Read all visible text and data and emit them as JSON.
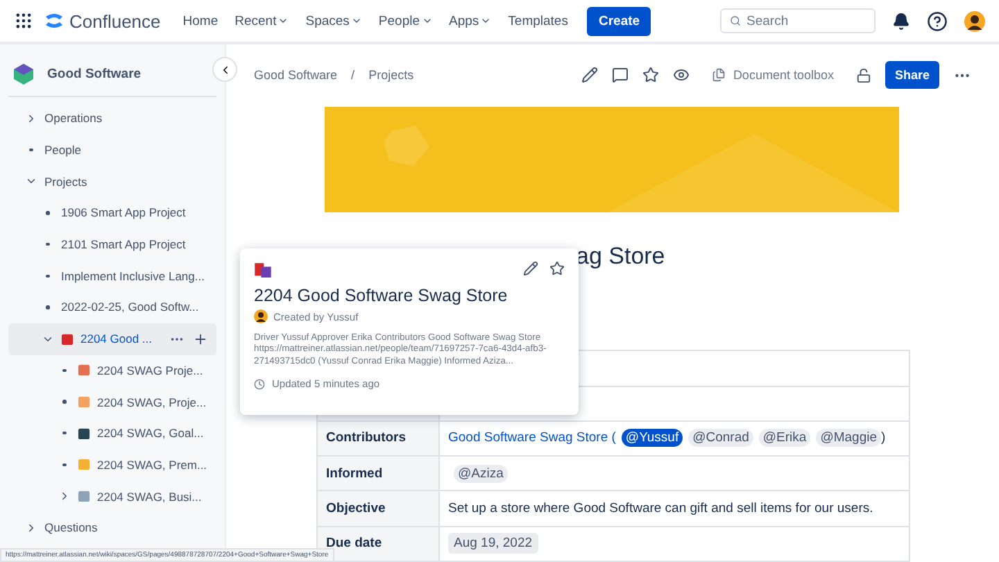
{
  "topnav": {
    "product": "Confluence",
    "links": [
      {
        "label": "Home",
        "dropdown": false
      },
      {
        "label": "Recent",
        "dropdown": true
      },
      {
        "label": "Spaces",
        "dropdown": true
      },
      {
        "label": "People",
        "dropdown": true
      },
      {
        "label": "Apps",
        "dropdown": true
      },
      {
        "label": "Templates",
        "dropdown": false
      }
    ],
    "create": "Create",
    "search": {
      "placeholder": "Search"
    }
  },
  "sidebar": {
    "space": "Good Software",
    "tree": [
      {
        "label": "Operations",
        "kind": "branch",
        "expanded": false,
        "selected": false
      },
      {
        "label": "People",
        "kind": "leaf",
        "selected": false
      },
      {
        "label": "Projects",
        "kind": "branch",
        "expanded": true,
        "selected": false,
        "children": [
          {
            "label": "1906 Smart App Project",
            "kind": "leaf",
            "selected": false
          },
          {
            "label": "2101 Smart App Project",
            "kind": "leaf",
            "selected": false
          },
          {
            "label": "Implement Inclusive Lang...",
            "kind": "leaf",
            "selected": false
          },
          {
            "label": "2022-02-25, Good Softw...",
            "kind": "leaf",
            "selected": false
          },
          {
            "label": "2204 Good ...",
            "kind": "branch",
            "expanded": true,
            "selected": true,
            "color": "#d62828",
            "children": [
              {
                "label": "2204 SWAG Proje...",
                "kind": "leaf",
                "selected": false,
                "color": "#e76f51"
              },
              {
                "label": "2204 SWAG, Proje...",
                "kind": "leaf",
                "selected": false,
                "color": "#f4a261"
              },
              {
                "label": "2204 SWAG, Goal...",
                "kind": "leaf",
                "selected": false,
                "color": "#264653"
              },
              {
                "label": "2204 SWAG, Prem...",
                "kind": "leaf",
                "selected": false,
                "color": "#f2b134"
              },
              {
                "label": "2204 SWAG, Busi...",
                "kind": "branch",
                "expanded": false,
                "selected": false,
                "color": "#8fa3b8"
              }
            ]
          }
        ]
      },
      {
        "label": "Questions",
        "kind": "branch",
        "expanded": false,
        "selected": false
      }
    ]
  },
  "page": {
    "breadcrumbs": [
      "Good Software",
      "Projects"
    ],
    "breadcrumb_separator": "/",
    "toolbox": "Document toolbox",
    "share": "Share",
    "title_visible": "ag Store",
    "table": [
      {
        "label": "Contributors",
        "cells": [
          {
            "kind": "link",
            "text": "Good Software Swag Store ("
          },
          {
            "kind": "mention",
            "text": "@Yussuf",
            "selected": true
          },
          {
            "kind": "mention",
            "text": "@Conrad",
            "selected": false
          },
          {
            "kind": "mention",
            "text": "@Erika",
            "selected": false
          },
          {
            "kind": "mention",
            "text": "@Maggie",
            "selected": false
          },
          {
            "kind": "text",
            "text": ")"
          }
        ]
      },
      {
        "label": "Informed",
        "cells": [
          {
            "kind": "mention",
            "text": "@Aziza",
            "selected": false
          }
        ]
      },
      {
        "label": "Objective",
        "cells": [
          {
            "kind": "text",
            "text": "Set up a store where Good Software can gift and sell items for our users."
          }
        ]
      },
      {
        "label": "Due date",
        "cells": [
          {
            "kind": "date",
            "text": "Aug 19, 2022"
          }
        ]
      }
    ]
  },
  "hover_card": {
    "title": "2204 Good Software Swag Store",
    "created_by": "Created by Yussuf",
    "excerpt": "Driver Yussuf Approver Erika Contributors Good Software Swag Store https://mattreiner.atlassian.net/people/team/71697257-7ca6-43d4-afb3-271493715dc0 (Yussuf Conrad Erika Maggie) Informed Aziza...",
    "updated": "Updated 5 minutes ago"
  },
  "status_url": "https://mattreiner.atlassian.net/wiki/spaces/GS/pages/498878728707/2204+Good+Software+Swag+Store"
}
